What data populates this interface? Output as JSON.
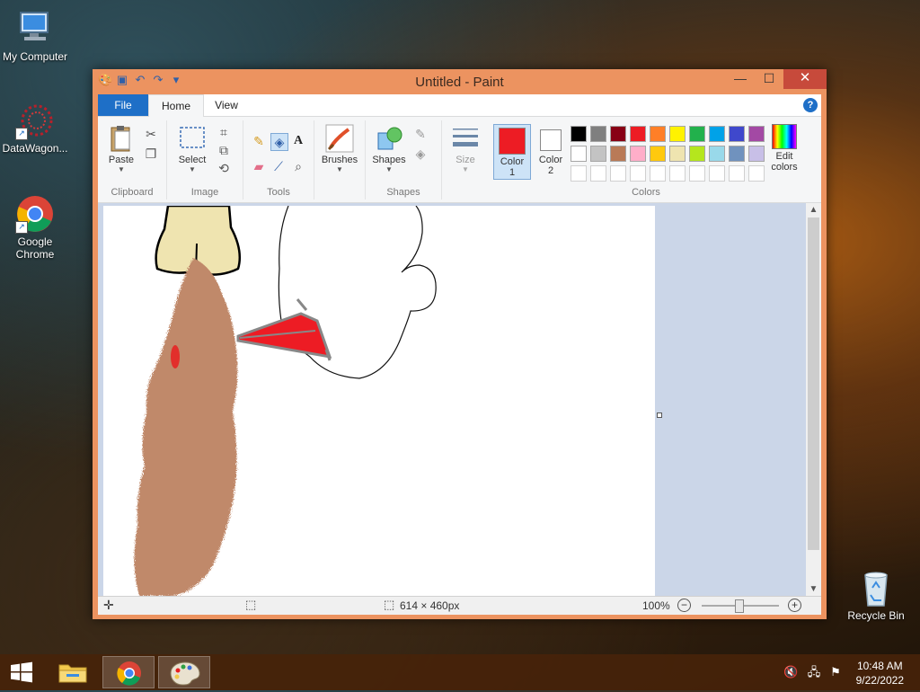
{
  "desktop": {
    "icons": [
      {
        "label": "My Computer",
        "icon": "computer-icon"
      },
      {
        "label": "DataWagon...",
        "icon": "datawagon-icon"
      },
      {
        "label": "Google Chrome",
        "icon": "chrome-icon"
      },
      {
        "label": "Recycle Bin",
        "icon": "recycle-bin-icon"
      }
    ]
  },
  "window": {
    "title": "Untitled - Paint",
    "controls": {
      "minimize": "—",
      "maximize": "☐",
      "close": "✕"
    }
  },
  "tabs": {
    "file": "File",
    "home": "Home",
    "view": "View"
  },
  "ribbon": {
    "clipboard": {
      "label": "Clipboard",
      "paste": "Paste"
    },
    "image": {
      "label": "Image",
      "select": "Select"
    },
    "tools": {
      "label": "Tools"
    },
    "brushes": {
      "label": "Brushes"
    },
    "shapes": {
      "label": "Shapes",
      "shapes_btn": "Shapes"
    },
    "size": {
      "label": "Size"
    },
    "colors": {
      "label": "Colors",
      "color1": "Color\n1",
      "color2": "Color\n2",
      "edit": "Edit\ncolors",
      "color1_value": "#ed1c24",
      "color2_value": "#ffffff",
      "palette_row1": [
        "#000000",
        "#7f7f7f",
        "#880015",
        "#ed1c24",
        "#ff7f27",
        "#fff200",
        "#22b14c",
        "#00a2e8",
        "#3f48cc",
        "#a349a4"
      ],
      "palette_row2": [
        "#ffffff",
        "#c3c3c3",
        "#b97a57",
        "#ffaec9",
        "#ffc90e",
        "#efe4b0",
        "#b5e61d",
        "#99d9ea",
        "#7092be",
        "#c8bfe7"
      ],
      "palette_row3": [
        "#ffffff",
        "#ffffff",
        "#ffffff",
        "#ffffff",
        "#ffffff",
        "#ffffff",
        "#ffffff",
        "#ffffff",
        "#ffffff",
        "#ffffff"
      ]
    }
  },
  "statusbar": {
    "canvas_size": "614 × 460px",
    "zoom": "100%"
  },
  "taskbar": {
    "time": "10:48 AM",
    "date": "9/22/2022"
  }
}
